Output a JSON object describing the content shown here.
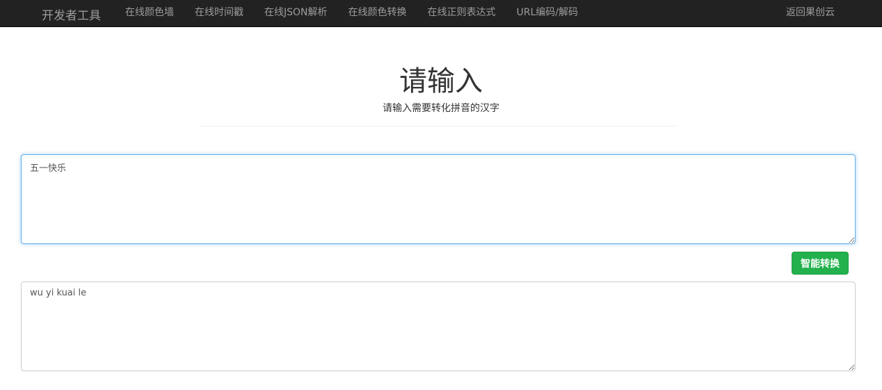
{
  "nav": {
    "brand": "开发者工具",
    "links": [
      "在线颜色墙",
      "在线时间戳",
      "在线JSON解析",
      "在线颜色转换",
      "在线正则表达式",
      "URL编码/解码"
    ],
    "back": "返回果创云"
  },
  "header": {
    "title": "请输入",
    "subtitle": "请输入需要转化拼音的汉字"
  },
  "input": {
    "value": "五一快乐"
  },
  "convert_label": "智能转换",
  "output": {
    "value": "wu yi kuai le"
  }
}
